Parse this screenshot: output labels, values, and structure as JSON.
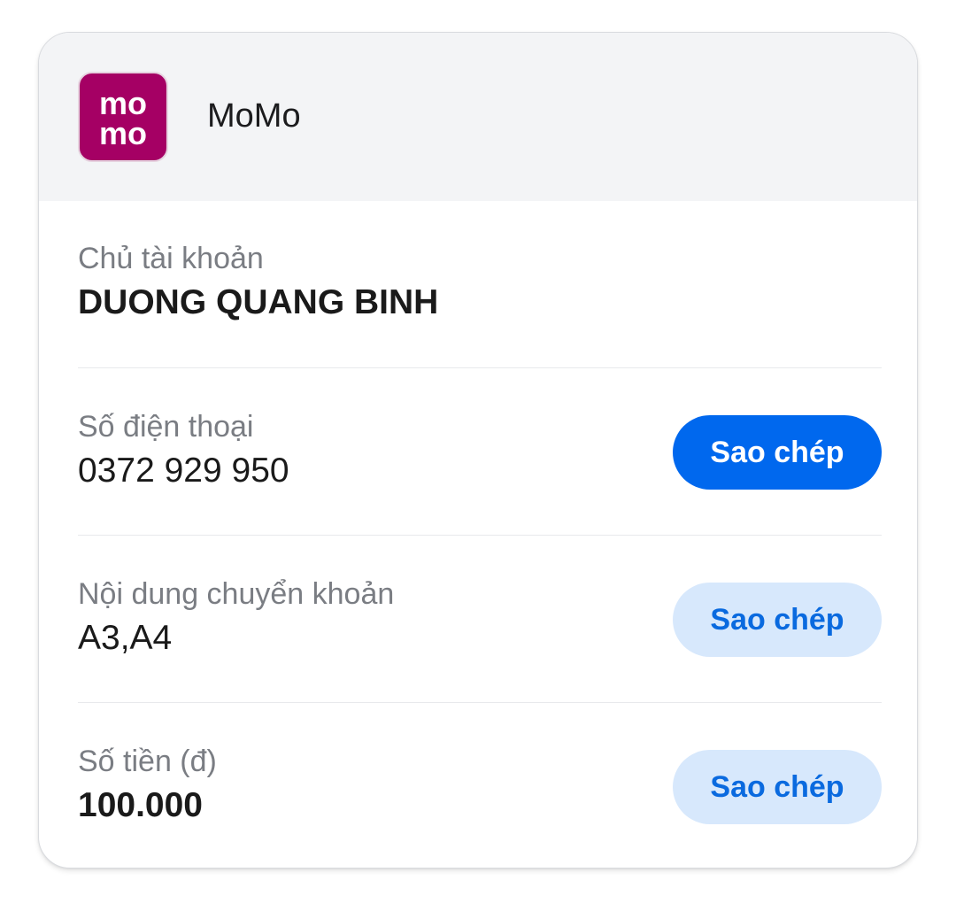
{
  "header": {
    "logo_text_top": "mo",
    "logo_text_bottom": "mo",
    "app_name": "MoMo",
    "logo_color": "#a50064"
  },
  "rows": [
    {
      "label": "Chủ tài khoản",
      "value": "DUONG QUANG BINH"
    },
    {
      "label": "Số điện thoại",
      "value": "0372 929 950",
      "button": "Sao chép"
    },
    {
      "label": "Nội dung chuyển khoản",
      "value": "A3,A4",
      "button": "Sao chép"
    },
    {
      "label": "Số tiền (đ)",
      "value": "100.000",
      "button": "Sao chép"
    }
  ],
  "colors": {
    "primary_button": "#0068ee",
    "secondary_button": "#d7e8fc",
    "secondary_button_text": "#0a6adf"
  }
}
